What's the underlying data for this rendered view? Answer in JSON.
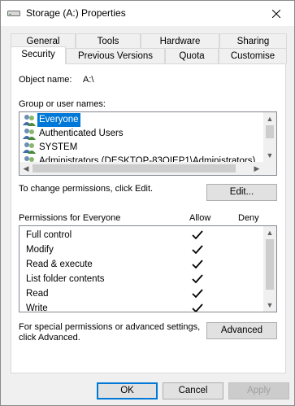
{
  "window": {
    "title": "Storage (A:) Properties",
    "close_glyph": "✕"
  },
  "tabs": {
    "back_row": [
      "General",
      "Tools",
      "Hardware",
      "Sharing"
    ],
    "front_row": [
      "Security",
      "Previous Versions",
      "Quota",
      "Customise"
    ],
    "selected": "Security"
  },
  "security": {
    "object_name_label": "Object name:",
    "object_name_value": "A:\\",
    "group_label": "Group or user names:",
    "groups": [
      {
        "name": "Everyone",
        "icon": "users-icon",
        "selected": true
      },
      {
        "name": "Authenticated Users",
        "icon": "users-icon",
        "selected": false
      },
      {
        "name": "SYSTEM",
        "icon": "users-icon",
        "selected": false
      },
      {
        "name": "Administrators (DESKTOP-83OIEP1\\Administrators)",
        "icon": "users-icon",
        "selected": false
      }
    ],
    "change_text": "To change permissions, click Edit.",
    "edit_label": "Edit...",
    "permissions_label": "Permissions for Everyone",
    "allow_label": "Allow",
    "deny_label": "Deny",
    "permissions": [
      {
        "name": "Full control",
        "allow": true,
        "deny": false
      },
      {
        "name": "Modify",
        "allow": true,
        "deny": false
      },
      {
        "name": "Read & execute",
        "allow": true,
        "deny": false
      },
      {
        "name": "List folder contents",
        "allow": true,
        "deny": false
      },
      {
        "name": "Read",
        "allow": true,
        "deny": false
      },
      {
        "name": "Write",
        "allow": true,
        "deny": false
      }
    ],
    "advanced_text_line1": "For special permissions or advanced settings,",
    "advanced_text_line2": "click Advanced.",
    "advanced_label": "Advanced"
  },
  "footer": {
    "ok_label": "OK",
    "cancel_label": "Cancel",
    "apply_label": "Apply"
  },
  "colors": {
    "accent": "#0078d7",
    "window_bg": "#f0f0f0",
    "check": "#000000"
  }
}
